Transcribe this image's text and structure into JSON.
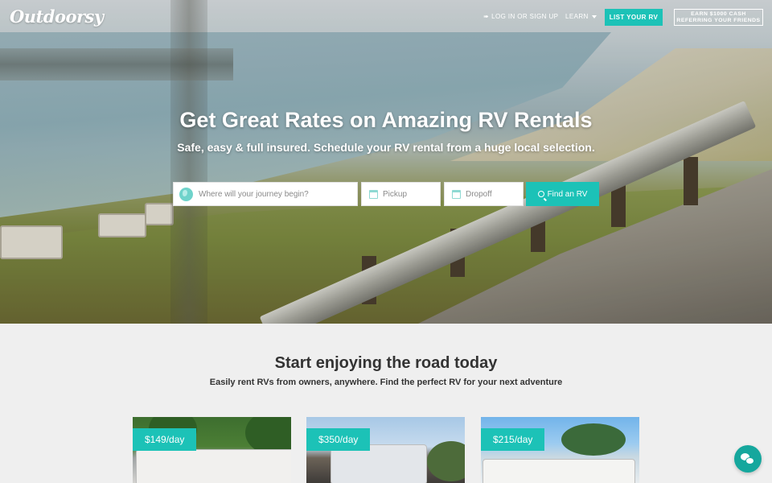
{
  "brand": {
    "logo_text": "Outdoorsy",
    "accent_color": "#1cc2b7"
  },
  "nav": {
    "login_label": "LOG IN OR SIGN UP",
    "learn_label": "LEARN",
    "list_rv_label": "LIST YOUR RV",
    "earn_line1": "EARN $1000 CASH",
    "earn_line2": "REFERRING YOUR FRIENDS"
  },
  "hero": {
    "title": "Get Great Rates on Amazing RV Rentals",
    "subtitle": "Safe, easy & full insured. Schedule your RV rental from a huge local selection."
  },
  "search": {
    "where_placeholder": "Where will your journey begin?",
    "pickup_placeholder": "Pickup",
    "dropoff_placeholder": "Dropoff",
    "button_label": "Find an RV"
  },
  "section": {
    "title": "Start enjoying the road today",
    "subtitle": "Easily rent RVs from owners, anywhere. Find the perfect RV for your next adventure"
  },
  "listings": [
    {
      "price": "$149/day"
    },
    {
      "price": "$350/day"
    },
    {
      "price": "$215/day"
    }
  ],
  "icons": {
    "login": "login-icon",
    "globe": "globe-icon",
    "calendar": "calendar-icon",
    "search": "search-icon",
    "chat": "chat-icon"
  }
}
